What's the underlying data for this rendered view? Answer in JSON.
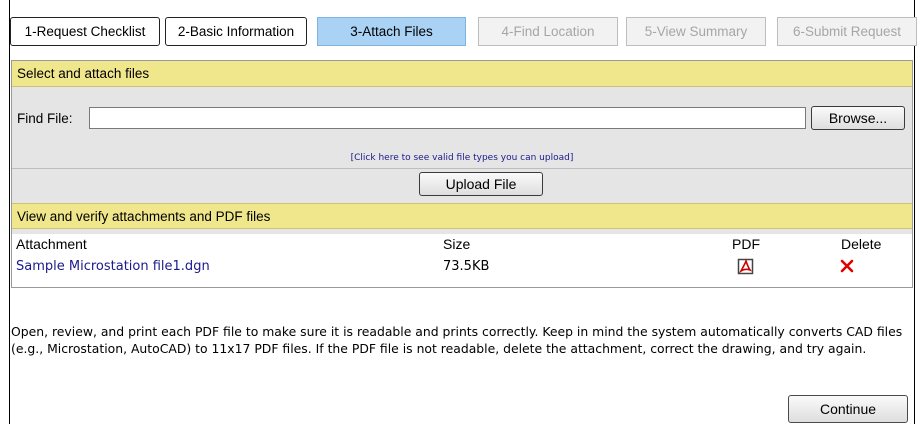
{
  "tabs": [
    {
      "label": "1-Request Checklist",
      "state": "done"
    },
    {
      "label": "2-Basic Information",
      "state": "done"
    },
    {
      "label": "3-Attach Files",
      "state": "active"
    },
    {
      "label": "4-Find Location",
      "state": "disabled"
    },
    {
      "label": "5-View Summary",
      "state": "disabled"
    },
    {
      "label": "6-Submit Request",
      "state": "disabled"
    }
  ],
  "attach_section": {
    "title": "Select and attach files",
    "find_label": "Find File:",
    "file_value": "",
    "browse_label": "Browse...",
    "hint_link": "[Click here to see valid file types you can upload]",
    "upload_label": "Upload File"
  },
  "verify_section": {
    "title": "View and verify attachments and PDF files",
    "columns": [
      "Attachment",
      "Size",
      "PDF",
      "Delete"
    ],
    "rows": [
      {
        "attachment": "Sample Microstation file1.dgn",
        "size": "73.5KB",
        "pdf_icon": "pdf-icon",
        "delete_icon": "red-x-icon"
      }
    ]
  },
  "note": "Open, review, and print each PDF file to make sure it is readable and prints correctly. Keep in mind the system automatically converts CAD files (e.g., Microstation, AutoCAD) to 11x17 PDF files. If the PDF file is not readable, delete the attachment, correct the drawing, and try again.",
  "continue_label": "Continue",
  "colors": {
    "section_bar": "#f0e68c",
    "active_tab": "#a9d2f5",
    "link": "#1a1a8c",
    "delete": "#e00000"
  }
}
